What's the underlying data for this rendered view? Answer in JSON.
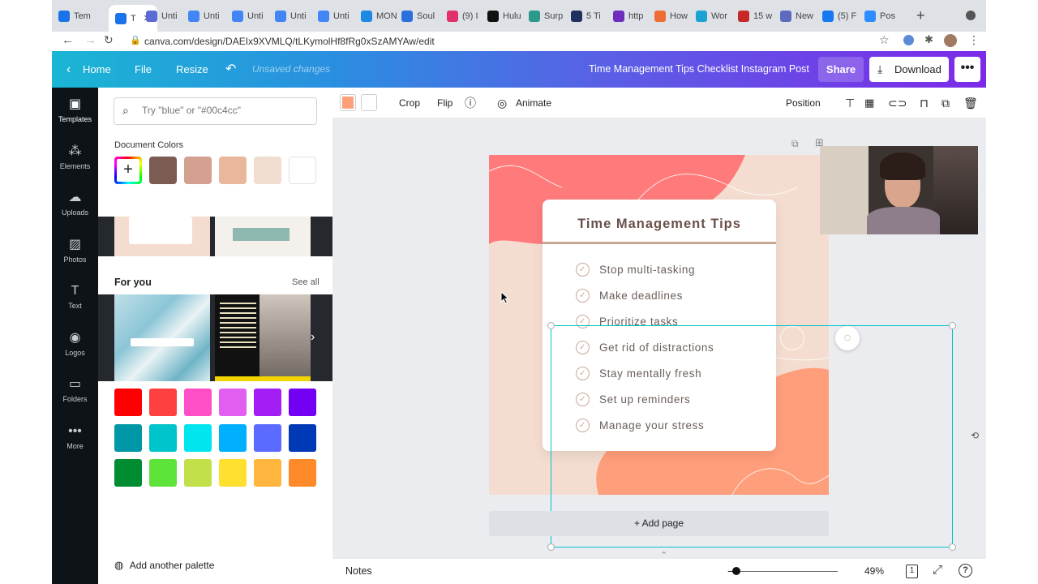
{
  "browser": {
    "tabs": [
      {
        "label": "Tem",
        "color": "#1a73e8"
      },
      {
        "label": "T",
        "color": "#1a73e8",
        "active": true
      },
      {
        "label": "Unti",
        "color": "#5b6bd6"
      },
      {
        "label": "Unti",
        "color": "#4285f4"
      },
      {
        "label": "Unti",
        "color": "#4285f4"
      },
      {
        "label": "Unti",
        "color": "#4285f4"
      },
      {
        "label": "Unti",
        "color": "#4285f4"
      },
      {
        "label": "MON",
        "color": "#1e88e5"
      },
      {
        "label": "Soul",
        "color": "#2a6fdb"
      },
      {
        "label": "(9) I",
        "color": "#e1306c"
      },
      {
        "label": "Hulu",
        "color": "#111"
      },
      {
        "label": "Surp",
        "color": "#2b9a8d"
      },
      {
        "label": "5 Ti",
        "color": "#22305e"
      },
      {
        "label": "http",
        "color": "#6f2dbd"
      },
      {
        "label": "How",
        "color": "#ef6c33"
      },
      {
        "label": "Wor",
        "color": "#1aa3d1"
      },
      {
        "label": "15 w",
        "color": "#c62828"
      },
      {
        "label": "New",
        "color": "#5c6bc0"
      },
      {
        "label": "(5) F",
        "color": "#1877f2"
      },
      {
        "label": "Pos",
        "color": "#2d8cff"
      }
    ],
    "url": "canva.com/design/DAEIx9XVMLQ/tLKymolHf8fRg0xSzAMYAw/edit"
  },
  "header": {
    "home": "Home",
    "file": "File",
    "resize": "Resize",
    "status": "Unsaved changes",
    "title": "Time Management Tips Checklist Instagram Post",
    "share": "Share",
    "download": "Download",
    "more": "•••"
  },
  "rail": [
    {
      "label": "Templates",
      "icon": "templates-icon"
    },
    {
      "label": "Elements",
      "icon": "elements-icon"
    },
    {
      "label": "Uploads",
      "icon": "uploads-icon"
    },
    {
      "label": "Photos",
      "icon": "photos-icon"
    },
    {
      "label": "Text",
      "icon": "text-icon"
    },
    {
      "label": "Logos",
      "icon": "logos-icon"
    },
    {
      "label": "Folders",
      "icon": "folders-icon"
    },
    {
      "label": "More",
      "icon": "more-icon"
    }
  ],
  "panel": {
    "search_placeholder": "Try \"blue\" or \"#00c4cc\"",
    "document_colors_title": "Document Colors",
    "document_colors": [
      "#7a5c52",
      "#d4a090",
      "#e8b79c",
      "#f1ddd0",
      "#ffffff"
    ],
    "for_you_title": "For you",
    "see_all": "See all",
    "palette_colors": [
      [
        "#ff0000",
        "#ff4040",
        "#ff4fc7",
        "#e05ef0",
        "#a21ef5",
        "#7300f5"
      ],
      [
        "#0097a7",
        "#00c4cc",
        "#00e5ee",
        "#00b0ff",
        "#5c6bff",
        "#0039b5"
      ],
      [
        "#008c31",
        "#5ee33b",
        "#c1e04a",
        "#ffe02e",
        "#ffb53e",
        "#ff8a2a"
      ]
    ],
    "add_palette": "Add another palette"
  },
  "toolbar": {
    "fill_color": "#ff9f7a",
    "crop": "Crop",
    "flip": "Flip",
    "animate": "Animate",
    "position": "Position"
  },
  "design": {
    "title": "Time Management Tips",
    "items": [
      "Stop multi-tasking",
      "Make deadlines",
      "Prioritize tasks",
      "Get rid of distractions",
      "Stay mentally fresh",
      "Set up reminders",
      "Manage your stress"
    ],
    "accent": "#ff7b7b",
    "peach": "#ff9e7a"
  },
  "canvas": {
    "add_page": "+ Add page"
  },
  "bottombar": {
    "notes": "Notes",
    "zoom": "49%",
    "page": "1"
  }
}
